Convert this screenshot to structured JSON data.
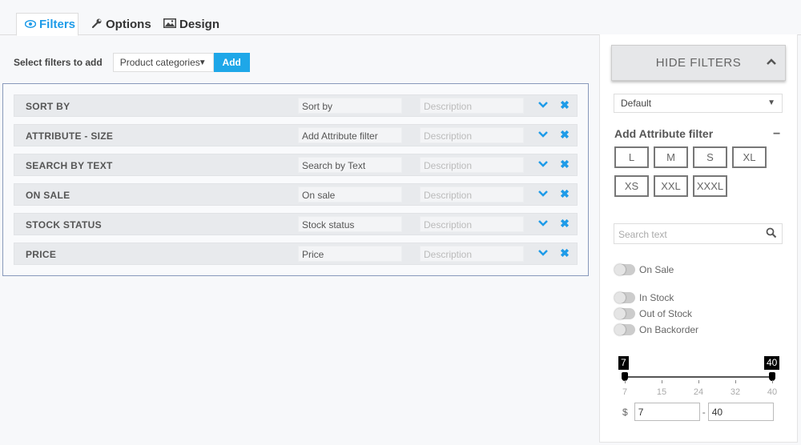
{
  "tabs": [
    {
      "label": "Filters",
      "icon": "eye-icon",
      "active": true
    },
    {
      "label": "Options",
      "icon": "wrench-icon",
      "active": false
    },
    {
      "label": "Design",
      "icon": "image-icon",
      "active": false
    }
  ],
  "add_bar": {
    "label": "Select filters to add",
    "select_value": "Product categories",
    "add_label": "Add"
  },
  "filters": [
    {
      "title": "SORT BY",
      "name": "Sort by",
      "description_placeholder": "Description"
    },
    {
      "title": "ATTRIBUTE - SIZE",
      "name": "Add Attribute filter",
      "description_placeholder": "Description"
    },
    {
      "title": "SEARCH BY TEXT",
      "name": "Search by Text",
      "description_placeholder": "Description"
    },
    {
      "title": "ON SALE",
      "name": "On sale",
      "description_placeholder": "Description"
    },
    {
      "title": "STOCK STATUS",
      "name": "Stock status",
      "description_placeholder": "Description"
    },
    {
      "title": "PRICE",
      "name": "Price",
      "description_placeholder": "Description"
    }
  ],
  "preview": {
    "hide_filters_label": "HIDE FILTERS",
    "sort_select_value": "Default",
    "attribute_heading": "Add Attribute filter",
    "collapse_symbol": "−",
    "sizes": [
      "L",
      "M",
      "S",
      "XL",
      "XS",
      "XXL",
      "XXXL"
    ],
    "search_placeholder": "Search text",
    "toggles": {
      "on_sale": "On Sale",
      "in_stock": "In Stock",
      "out_of_stock": "Out of Stock",
      "on_backorder": "On Backorder"
    },
    "price_range": {
      "min": 7,
      "max": 40,
      "ticks": [
        "7",
        "15",
        "24",
        "32",
        "40"
      ],
      "currency": "$",
      "separator": "-",
      "min_value": "7",
      "max_value": "40"
    }
  },
  "colors": {
    "accent": "#1ea7e8",
    "border_highlight": "#8899bb"
  }
}
